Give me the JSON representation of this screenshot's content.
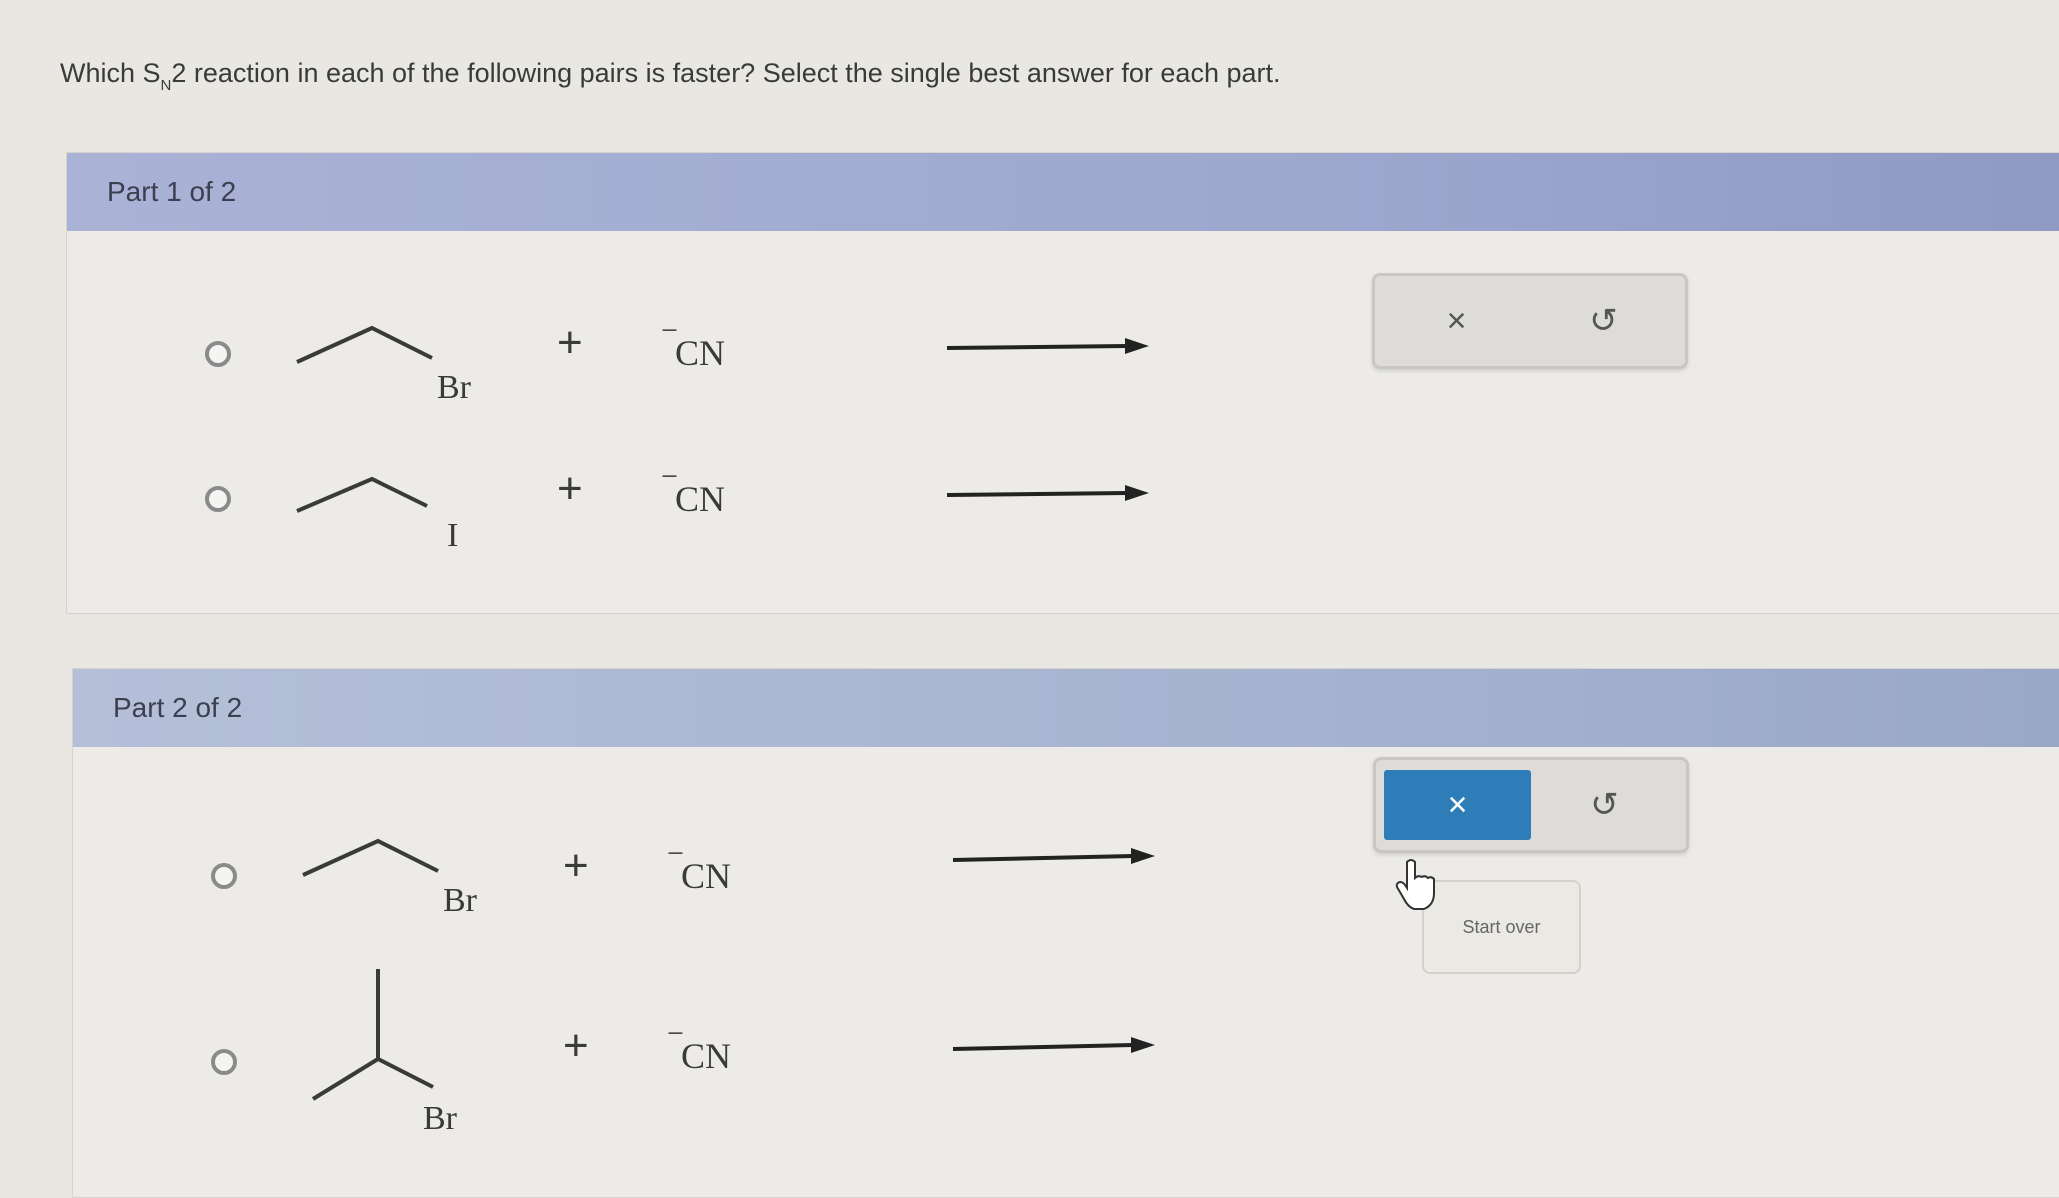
{
  "question": {
    "prefix": "Which S",
    "subscript": "N",
    "suffix": "2 reaction in each of the following pairs is faster? Select the single best answer for each part."
  },
  "parts": [
    {
      "title": "Part 1 of 2",
      "options": [
        {
          "halogen": "Br",
          "plus": "+",
          "charge": "−",
          "reagent": "CN"
        },
        {
          "halogen": "I",
          "plus": "+",
          "charge": "−",
          "reagent": "CN"
        }
      ],
      "toolbar": {
        "clear_icon": "×",
        "undo_icon": "↺"
      }
    },
    {
      "title": "Part 2 of 2",
      "options": [
        {
          "halogen": "Br",
          "plus": "+",
          "charge": "−",
          "reagent": "CN"
        },
        {
          "halogen": "Br",
          "plus": "+",
          "charge": "−",
          "reagent": "CN"
        }
      ],
      "toolbar": {
        "clear_icon": "×",
        "undo_icon": "↺"
      }
    }
  ],
  "tooltip": "Start over",
  "colors": {
    "active_button": "#2f7db8",
    "header": "#9ea8cf"
  }
}
